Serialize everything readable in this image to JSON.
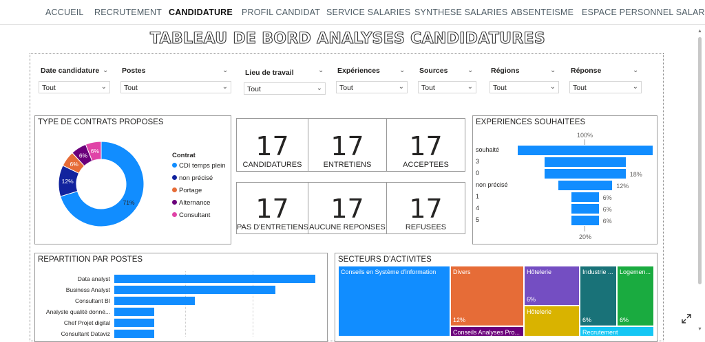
{
  "nav": {
    "items": [
      {
        "label": "ACCUEIL",
        "active": false
      },
      {
        "label": "RECRUTEMENT",
        "active": false
      },
      {
        "label": "CANDIDATURE",
        "active": true
      },
      {
        "label": "PROFIL CANDIDAT",
        "active": false
      },
      {
        "label": "SERVICE SALARIES",
        "active": false
      },
      {
        "label": "SYNTHESE SALARIES",
        "active": false
      },
      {
        "label": "ABSENTEISME",
        "active": false
      },
      {
        "label": "ESPACE PERSONNEL SALARIE",
        "active": false
      }
    ]
  },
  "page_title": "TABLEAU DE BORD ANALYSES CANDIDATURES",
  "filters": [
    {
      "label": "Date candidature",
      "value": "Tout"
    },
    {
      "label": "Postes",
      "value": "Tout"
    },
    {
      "label": "Lieu de travail",
      "value": "Tout"
    },
    {
      "label": "Expériences",
      "value": "Tout"
    },
    {
      "label": "Sources",
      "value": "Tout"
    },
    {
      "label": "Régions",
      "value": "Tout"
    },
    {
      "label": "Réponse",
      "value": "Tout"
    }
  ],
  "contracts": {
    "title": "TYPE DE CONTRATS PROPOSES",
    "legend_title": "Contrat",
    "items": [
      {
        "label": "CDI temps plein",
        "value": 71,
        "display": "71%",
        "color": "#118dff"
      },
      {
        "label": "non précisé",
        "value": 12,
        "display": "12%",
        "color": "#12239e"
      },
      {
        "label": "Portage",
        "value": 6,
        "display": "6%",
        "color": "#e66c37"
      },
      {
        "label": "Alternance",
        "value": 6,
        "display": "6%",
        "color": "#6b007b"
      },
      {
        "label": "Consultant",
        "value": 6,
        "display": "6%",
        "color": "#e044a7"
      }
    ]
  },
  "kpis": [
    {
      "value": "17",
      "label": "CANDIDATURES"
    },
    {
      "value": "17",
      "label": "ENTRETIENS"
    },
    {
      "value": "17",
      "label": "ACCEPTEES"
    },
    {
      "value": "17",
      "label": "PAS D'ENTRETIENS"
    },
    {
      "value": "17",
      "label": "AUCUNE REPONSES"
    },
    {
      "value": "17",
      "label": "REFUSEES"
    }
  ],
  "experiences": {
    "title": "EXPERIENCES SOUHAITEES",
    "top_label": "100%",
    "bottom_label": "20%",
    "items": [
      {
        "label": "souhaité",
        "value": 100,
        "pct": ""
      },
      {
        "label": "3",
        "value": 60,
        "pct": ""
      },
      {
        "label": "0",
        "value": 60,
        "pct": "18%"
      },
      {
        "label": "non précisé",
        "value": 40,
        "pct": "12%"
      },
      {
        "label": "1",
        "value": 20,
        "pct": "6%"
      },
      {
        "label": "4",
        "value": 20,
        "pct": "6%"
      },
      {
        "label": "5",
        "value": 20,
        "pct": "6%"
      }
    ]
  },
  "postes": {
    "title": "REPARTITION PAR POSTES",
    "items": [
      {
        "label": "Data analyst",
        "value": 5
      },
      {
        "label": "Business Analyst",
        "value": 4
      },
      {
        "label": "Consultant BI",
        "value": 2
      },
      {
        "label": "Analyste qualité donné...",
        "value": 1
      },
      {
        "label": "Chef Projet digital",
        "value": 1
      },
      {
        "label": "Consultant Dataviz",
        "value": 1
      }
    ],
    "max": 5
  },
  "secteurs": {
    "title": "SECTEURS D'ACTIVITES",
    "tiles": [
      {
        "name": "Conseils en Système d'information",
        "value": "",
        "color": "#118dff"
      },
      {
        "name": "Divers",
        "value": "12%",
        "color": "#e66c37"
      },
      {
        "name": "Conseils Analyses Pro...",
        "value": "",
        "color": "#6b007b"
      },
      {
        "name": "Hôtelerie",
        "value": "6%",
        "color": "#744ec2"
      },
      {
        "name": "Hôtelerie",
        "value": "",
        "color": "#d9b300"
      },
      {
        "name": "Industrie ...",
        "value": "6%",
        "color": "#197278"
      },
      {
        "name": "Logemen...",
        "value": "6%",
        "color": "#1aab40"
      },
      {
        "name": "Recrutement",
        "value": "",
        "color": "#15c6f4"
      }
    ]
  }
}
